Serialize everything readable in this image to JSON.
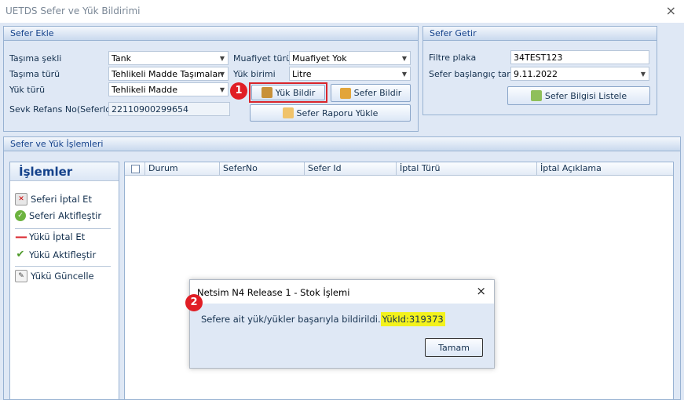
{
  "window": {
    "title": "UETDS Sefer ve Yük Bildirimi",
    "close": "×"
  },
  "sefer_ekle": {
    "header": "Sefer Ekle",
    "tasima_sekli": {
      "label": "Taşıma şekli",
      "value": "Tank"
    },
    "tasima_turu": {
      "label": "Taşıma türü",
      "value": "Tehlikeli Madde Taşımaları"
    },
    "yuk_turu": {
      "label": "Yük türü",
      "value": "Tehlikeli Madde"
    },
    "sevk_refans": {
      "label": "Sevk Refans No(SeferId)",
      "value": "22110900299654"
    },
    "muafiyet_turu": {
      "label": "Muafiyet türü",
      "value": "Muafiyet Yok"
    },
    "yuk_birimi": {
      "label": "Yük birimi",
      "value": "Litre"
    },
    "yuk_bildir": "Yük Bildir",
    "sefer_bildir": "Sefer Bildir",
    "sefer_raporu_yukle": "Sefer Raporu Yükle"
  },
  "sefer_getir": {
    "header": "Sefer Getir",
    "filtre_plaka": {
      "label": "Filtre plaka",
      "value": "34TEST123"
    },
    "sefer_baslangic": {
      "label": "Sefer başlangıç tarihi",
      "value": "9.11.2022"
    },
    "listele": "Sefer Bilgisi Listele"
  },
  "islemler_panel": {
    "header": "Sefer ve Yük İşlemleri",
    "title": "İşlemler",
    "items": [
      "Seferi İptal Et",
      "Seferi Aktifleştir",
      "Yükü İptal Et",
      "Yükü Aktifleştir",
      "Yükü Güncelle"
    ]
  },
  "grid": {
    "columns": [
      "Durum",
      "SeferNo",
      "Sefer Id",
      "İptal Türü",
      "İptal Açıklama"
    ]
  },
  "dialog": {
    "title": "Netsim N4 Release 1 - Stok İşlemi",
    "message": "Sefere ait yük/yükler başarıyla bildirildi.",
    "highlight": "YükId:319373",
    "ok": "Tamam",
    "close": "×"
  },
  "annotations": {
    "badge1": "1",
    "badge2": "2"
  },
  "colors": {
    "accent_red": "#e01e25",
    "highlight_yellow": "#f3f21c",
    "panel_bg": "#dfe8f5"
  }
}
